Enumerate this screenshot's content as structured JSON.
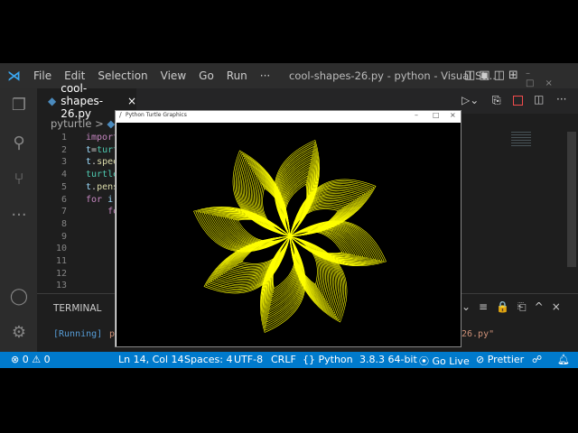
{
  "titlebar": {
    "menu": [
      "File",
      "Edit",
      "Selection",
      "View",
      "Go",
      "Run",
      "···"
    ],
    "title": "cool-shapes-26.py - python - Visual St..."
  },
  "tab": {
    "label": "cool-shapes-26.py",
    "close": "×"
  },
  "breadcrumb": {
    "folder": "pyturtle",
    "sep": ">"
  },
  "code": {
    "line_numbers": [
      "1",
      "2",
      "3",
      "4",
      "5",
      "6",
      "7",
      "8",
      "9",
      "10",
      "11",
      "12",
      "13"
    ],
    "lines": [
      [
        {
          "t": "import",
          "c": "#c586c0"
        }
      ],
      [
        {
          "t": "t",
          "c": "#9cdcfe"
        },
        {
          "t": "=",
          "c": "#d4d4d4"
        },
        {
          "t": "turt",
          "c": "#4ec9b0"
        }
      ],
      [
        {
          "t": "t",
          "c": "#9cdcfe"
        },
        {
          "t": ".",
          "c": "#d4d4d4"
        },
        {
          "t": "spee",
          "c": "#dcdcaa"
        }
      ],
      [
        {
          "t": "turtle",
          "c": "#4ec9b0"
        }
      ],
      [
        {
          "t": "t",
          "c": "#9cdcfe"
        },
        {
          "t": ".",
          "c": "#d4d4d4"
        },
        {
          "t": "pens",
          "c": "#dcdcaa"
        }
      ],
      [
        {
          "t": "for",
          "c": "#c586c0"
        },
        {
          "t": " i ",
          "c": "#9cdcfe"
        }
      ],
      [
        {
          "t": "    fo",
          "c": "#c586c0"
        }
      ]
    ]
  },
  "panel": {
    "tab": "TERMINAL",
    "running": "[Running]",
    "cmd_start": "py",
    "cmd_end": "26.py\""
  },
  "turtle": {
    "title": "Python Turtle Graphics",
    "min": "–",
    "max": "□",
    "close": "×",
    "petals": 8,
    "color": "#ffff00"
  },
  "status": {
    "errors": "0",
    "warnings": "0",
    "position": "Ln 14, Col 14",
    "spaces": "Spaces: 4",
    "encoding": "UTF-8",
    "eol": "CRLF",
    "language": "Python",
    "interpreter": "3.8.3 64-bit",
    "golive": "Go Live",
    "prettier": "Prettier"
  }
}
